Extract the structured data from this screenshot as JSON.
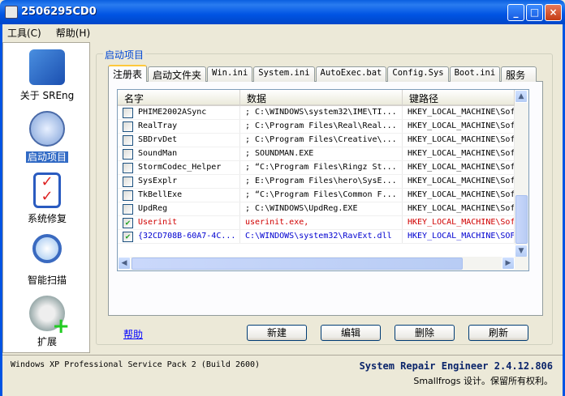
{
  "window": {
    "title": "2506295CD0",
    "minimize": "_",
    "maximize": "□",
    "close": "×"
  },
  "menu": [
    "工具(C)",
    "帮助(H)"
  ],
  "sidebar": {
    "items": [
      {
        "label": "关于 SREng",
        "icon": "tools-icon"
      },
      {
        "label": "启动项目",
        "icon": "clock-icon",
        "selected": true
      },
      {
        "label": "系统修复",
        "icon": "checklist-icon"
      },
      {
        "label": "智能扫描",
        "icon": "magnifier-icon"
      },
      {
        "label": "扩展",
        "icon": "gear-plus-icon"
      }
    ]
  },
  "group": {
    "title": "启动项目"
  },
  "tabs": [
    "注册表",
    "启动文件夹",
    "Win.ini",
    "System.ini",
    "AutoExec.bat",
    "Config.Sys",
    "Boot.ini",
    "服务"
  ],
  "list": {
    "columns": [
      "名字",
      "数据",
      "键路径"
    ],
    "rows": [
      {
        "checked": false,
        "name": "PHIME2002ASync",
        "data": "; C:\\WINDOWS\\system32\\IME\\TI...",
        "path": "HKEY_LOCAL_MACHINE\\Sof",
        "color": ""
      },
      {
        "checked": false,
        "name": "RealTray",
        "data": "; C:\\Program Files\\Real\\Real...",
        "path": "HKEY_LOCAL_MACHINE\\Sof",
        "color": ""
      },
      {
        "checked": false,
        "name": "SBDrvDet",
        "data": "; C:\\Program Files\\Creative\\...",
        "path": "HKEY_LOCAL_MACHINE\\Sof",
        "color": ""
      },
      {
        "checked": false,
        "name": "SoundMan",
        "data": "; SOUNDMAN.EXE",
        "path": "HKEY_LOCAL_MACHINE\\Sof",
        "color": ""
      },
      {
        "checked": false,
        "name": "StormCodec_Helper",
        "data": "; “C:\\Program Files\\Ringz St...",
        "path": "HKEY_LOCAL_MACHINE\\Sof",
        "color": ""
      },
      {
        "checked": false,
        "name": "SysExplr",
        "data": "; E:\\Program Files\\hero\\SysE...",
        "path": "HKEY_LOCAL_MACHINE\\Sof",
        "color": ""
      },
      {
        "checked": false,
        "name": "TkBellExe",
        "data": "; “C:\\Program Files\\Common F...",
        "path": "HKEY_LOCAL_MACHINE\\Sof",
        "color": ""
      },
      {
        "checked": false,
        "name": "UpdReg",
        "data": "; C:\\WINDOWS\\UpdReg.EXE",
        "path": "HKEY_LOCAL_MACHINE\\Sof",
        "color": ""
      },
      {
        "checked": true,
        "name": "Userinit",
        "data": "userinit.exe,",
        "path": "HKEY_LOCAL_MACHINE\\Sof",
        "color": "red"
      },
      {
        "checked": true,
        "name": "{32CD708B-60A7-4C...",
        "data": "C:\\WINDOWS\\system32\\RavExt.dll",
        "path": "HKEY_LOCAL_MACHINE\\SOF",
        "color": "blue"
      }
    ]
  },
  "help": "帮助",
  "buttons": {
    "new": "新建",
    "edit": "编辑",
    "delete": "删除",
    "refresh": "刷新"
  },
  "status": {
    "os": "Windows XP Professional Service Pack 2 (Build 2600)",
    "product": "System Repair Engineer 2.4.12.806",
    "copyright": "Smallfrogs 设计。保留所有权利。"
  }
}
